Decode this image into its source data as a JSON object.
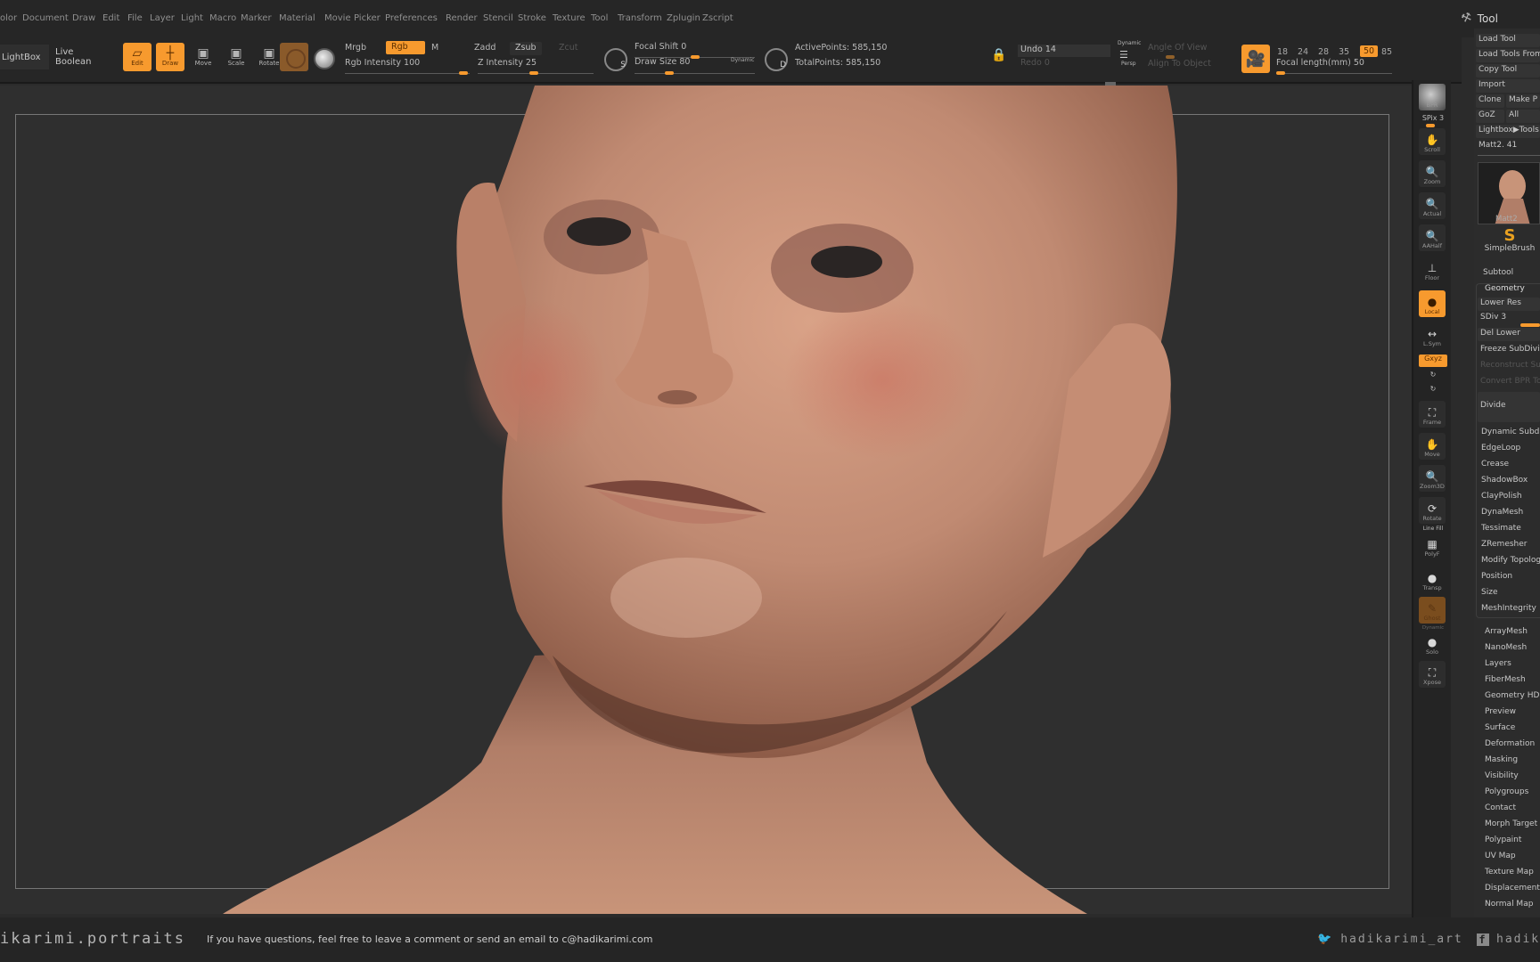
{
  "menu": {
    "items": [
      "olor",
      "Document",
      "Draw",
      "Edit",
      "File",
      "Layer",
      "Light",
      "Macro",
      "Marker",
      "Material",
      "Movie",
      "Picker",
      "Preferences",
      "Render",
      "Stencil",
      "Stroke",
      "Texture",
      "Tool",
      "Transform",
      "Zplugin",
      "Zscript"
    ],
    "tool_title": "Tool"
  },
  "shelf": {
    "lightbox": "LightBox",
    "live_boolean": "Live Boolean",
    "edit": "Edit",
    "draw": "Draw",
    "move": "Move",
    "scale": "Scale",
    "rotate": "Rotate",
    "mrgb": "Mrgb",
    "rgb": "Rgb",
    "m": "M",
    "rgb_intensity": "Rgb Intensity 100",
    "zadd": "Zadd",
    "zsub": "Zsub",
    "zcut": "Zcut",
    "z_intensity": "Z Intensity 25",
    "focal_shift": "Focal Shift 0",
    "draw_size": "Draw Size 80",
    "dynamic": "Dynamic",
    "active_points": "ActivePoints: 585,150",
    "total_points": "TotalPoints: 585,150",
    "undo": "Undo 14",
    "redo": "Redo 0",
    "persp_top": "Dynamic",
    "persp": "Persp",
    "angle_of_view": "Angle Of View",
    "align_to_object": "Align To Object",
    "focal_lengths": [
      "18",
      "24",
      "28",
      "35",
      "50",
      "85"
    ],
    "focal_selected": "50",
    "focal_length": "Focal length(mm) 50",
    "s_label": "S",
    "d_label": "D"
  },
  "right_icons": {
    "bpr": "BPR",
    "spix": "SPix 3",
    "scroll": "Scroll",
    "zoom": "Zoom",
    "actual": "Actual",
    "aahalf": "AAHalf",
    "floor": "Floor",
    "local": "Local",
    "lsym": "L.Sym",
    "xyz": "Gxyz",
    "frame": "Frame",
    "move": "Move",
    "zoom3d": "Zoom3D",
    "rotate": "Rotate",
    "linefill": "Line Fill",
    "polyf": "PolyF",
    "transp": "Transp",
    "ghost": "Ghost",
    "dynamic": "Dynamic",
    "solo": "Solo",
    "xpose": "Xpose"
  },
  "tool_panel": {
    "load_tool": "Load Tool",
    "load_tools_from": "Load Tools From",
    "copy_tool": "Copy Tool",
    "import": "Import",
    "clone": "Clone",
    "make_p": "Make P",
    "goz": "GoZ",
    "all": "All",
    "lightbox_tools": "Lightbox▶Tools",
    "current_tool": "Matt2. 41",
    "thumb_caption": "Matt2",
    "simplebrush": "SimpleBrush",
    "subtool": "Subtool",
    "geometry": "Geometry",
    "lower_res": "Lower Res",
    "sdiv": "SDiv 3",
    "del_lower": "Del Lower",
    "freeze": "Freeze SubDivis",
    "reconstruct": "Reconstruct Sub",
    "convert_bpr": "Convert BPR To",
    "divide": "Divide",
    "geometry_items": [
      "Dynamic Subdiv",
      "EdgeLoop",
      "Crease",
      "ShadowBox",
      "ClayPolish",
      "DynaMesh",
      "Tessimate",
      "ZRemesher",
      "Modify Topology",
      "Position",
      "Size",
      "MeshIntegrity"
    ],
    "sections": [
      "ArrayMesh",
      "NanoMesh",
      "Layers",
      "FiberMesh",
      "Geometry HD",
      "Preview",
      "Surface",
      "Deformation",
      "Masking",
      "Visibility",
      "Polygroups",
      "Contact",
      "Morph Target",
      "Polypaint",
      "UV Map",
      "Texture Map",
      "Displacement M",
      "Normal Map"
    ]
  },
  "footer": {
    "brand": "ikarimi.portraits",
    "message": "If you have questions, feel free to leave a comment or send an email to c@hadikarimi.com",
    "twitter": "hadikarimi_art",
    "facebook": "hadika"
  },
  "colors": {
    "accent": "#f79a2e",
    "background": "#2b2b2b",
    "skin": "#c89479"
  }
}
